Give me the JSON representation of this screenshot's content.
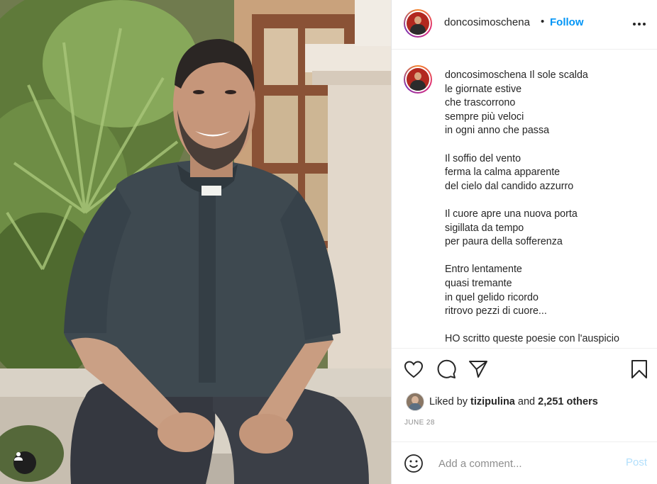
{
  "post": {
    "username": "doncosimoschena",
    "follow_label": "Follow",
    "header_separator": "•",
    "more_icon": "more-horizontal-icon",
    "caption_lines": [
      [
        "Il sole scalda",
        "le giornate estive",
        "che trascorrono",
        "sempre più veloci",
        "in ogni anno che passa"
      ],
      [
        "Il soffio del vento",
        "ferma la calma apparente",
        "del cielo dal candido azzurro"
      ],
      [
        "Il cuore apre una nuova porta",
        "sigillata da tempo",
        "per paura della sofferenza"
      ],
      [
        "Entro lentamente",
        "quasi tremante",
        "in quel gelido ricordo",
        "ritrovo pezzi di cuore..."
      ],
      [
        "HO scritto queste poesie con l'auspicio"
      ]
    ],
    "liked_by_prefix": "Liked by",
    "liked_by_user": "tizipulina",
    "liked_by_and": "and",
    "liked_by_others": "2,251 others",
    "date": "JUNE 28",
    "comment_placeholder": "Add a comment...",
    "post_label": "Post"
  },
  "icons": {
    "like": "heart-icon",
    "comment": "comment-icon",
    "share": "paper-plane-icon",
    "save": "bookmark-icon",
    "emoji": "smiley-icon",
    "tag": "user-tag-icon"
  },
  "colors": {
    "accent": "#0095f6",
    "post_disabled": "#b2dffc",
    "text": "#262626",
    "muted": "#8e8e8e"
  }
}
